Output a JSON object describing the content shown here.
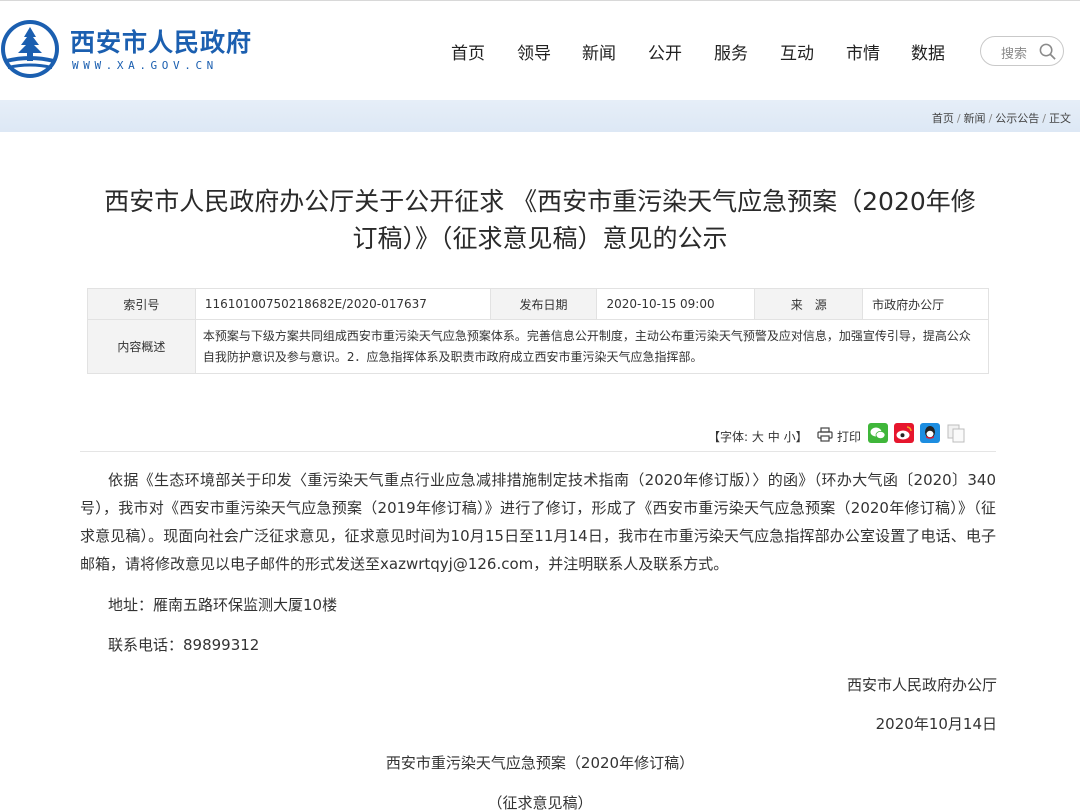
{
  "site": {
    "name": "西安市人民政府",
    "url": "WWW.XA.GOV.CN",
    "brand_color": "#1b5fb0"
  },
  "nav": {
    "items": [
      {
        "label": "首页"
      },
      {
        "label": "领导"
      },
      {
        "label": "新闻"
      },
      {
        "label": "公开"
      },
      {
        "label": "服务"
      },
      {
        "label": "互动"
      },
      {
        "label": "市情"
      },
      {
        "label": "数据"
      }
    ]
  },
  "search": {
    "placeholder": "搜索",
    "icon": "search-icon"
  },
  "breadcrumb": {
    "items": [
      "首页",
      "新闻",
      "公示公告",
      "正文"
    ],
    "separator": "/"
  },
  "article": {
    "title_line1": "西安市人民政府办公厅关于公开征求 《西安市重污染天气应急预案（2020年修",
    "title_line2": "订稿）》（征求意见稿）意见的公示",
    "meta": {
      "index_label": "索引号",
      "index_value": "11610100750218682E/2020-017637",
      "date_label": "发布日期",
      "date_value": "2020-10-15 09:00",
      "source_label": "来　源",
      "source_value": "市政府办公厅",
      "summary_label": "内容概述",
      "summary_value": "本预案与下级方案共同组成西安市重污染天气应急预案体系。完善信息公开制度，主动公布重污染天气预警及应对信息，加强宣传引导，提高公众自我防护意识及参与意识。2．应急指挥体系及职责市政府成立西安市重污染天气应急指挥部。"
    },
    "toolbar": {
      "font_open": "【字体:",
      "font_large": "大",
      "font_medium": "中",
      "font_small": "小",
      "font_close": "】",
      "print_label": "打印",
      "share_icons": [
        "wechat-icon",
        "weibo-icon",
        "qq-icon",
        "copy-icon"
      ]
    },
    "body": {
      "paragraph1": "依据《生态环境部关于印发〈重污染天气重点行业应急减排措施制定技术指南（2020年修订版）〉的函》（环办大气函〔2020〕340号），我市对《西安市重污染天气应急预案（2019年修订稿）》进行了修订，形成了《西安市重污染天气应急预案（2020年修订稿）》（征求意见稿）。现面向社会广泛征求意见，征求意见时间为10月15日至11月14日，我市在市重污染天气应急指挥部办公室设置了电话、电子邮箱，请将修改意见以电子邮件的形式发送至xazwrtqyj@126.com，并注明联系人及联系方式。",
      "address": "地址：雁南五路环保监测大厦10楼",
      "phone": "联系电话：89899312",
      "signature": "西安市人民政府办公厅",
      "date": "2020年10月14日",
      "attachment_title": "西安市重污染天气应急预案（2020年修订稿）",
      "attachment_subtitle": "（征求意见稿）"
    }
  }
}
